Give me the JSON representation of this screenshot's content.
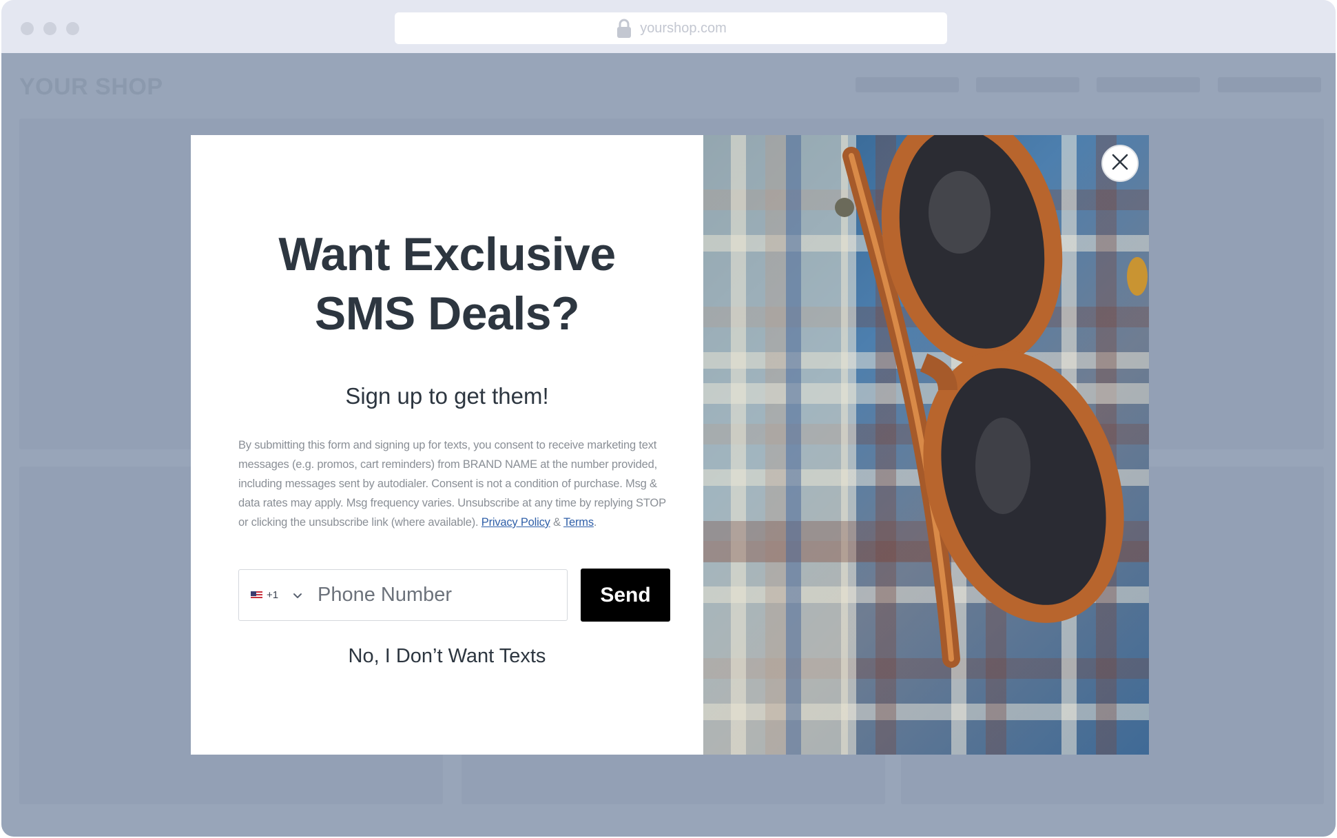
{
  "browser": {
    "url": "yourshop.com",
    "icons": [
      "lock-icon"
    ]
  },
  "shop": {
    "logo": "YOUR SHOP"
  },
  "popup": {
    "headline_line1": "Want Exclusive",
    "headline_line2": "SMS Deals?",
    "subheading": "Sign up to get them!",
    "legal_text": "By submitting this form and signing up for texts, you consent to receive marketing text messages (e.g. promos, cart reminders) from BRAND NAME at the number provided, including messages sent by autodialer. Consent is not a condition of purchase. Msg & data rates may apply. Msg frequency varies. Unsubscribe at any time by replying STOP or clicking the unsubscribe link (where available).",
    "privacy_link": "Privacy Policy",
    "ampersand": "&",
    "terms_link": "Terms",
    "period": ".",
    "country_code": "+1",
    "country_flag": "us-flag-icon",
    "phone_placeholder": "Phone Number",
    "phone_value": "",
    "send_label": "Send",
    "decline_label": "No, I Don’t Want Texts",
    "image_description_icon": "sunglasses-on-plaid-shirt-image"
  },
  "colors": {
    "page_background": "#98a5b9",
    "chrome_bar": "#e4e7f1",
    "headline_text": "#2d3640",
    "legal_text": "#8a8f96",
    "link": "#2f5fa8",
    "send_button_bg": "#000000",
    "send_button_text": "#ffffff"
  }
}
